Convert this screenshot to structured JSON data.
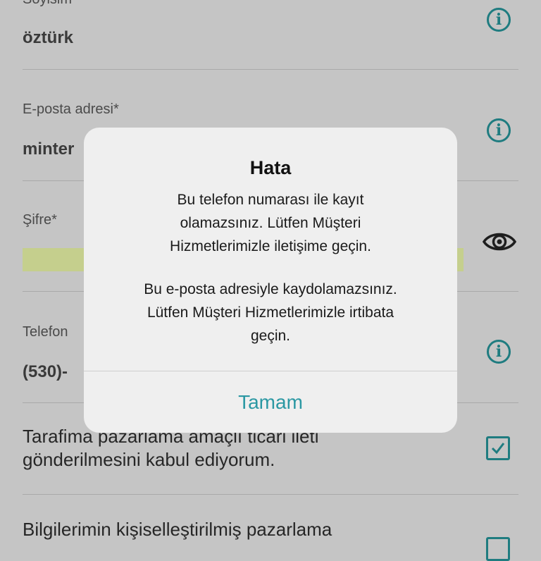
{
  "form": {
    "surname": {
      "label": "Soyisim",
      "value": "öztürk"
    },
    "email": {
      "label": "E-posta adresi*",
      "value": "minter"
    },
    "password": {
      "label": "Şifre*"
    },
    "phone": {
      "label": "Telefon",
      "value": "(530)-"
    },
    "consent_marketing": {
      "text_line1": "Tarafima pazarlama amaçlı ticari ileti",
      "text_line2": "gönderilmesini kabul ediyorum.",
      "checked": true
    },
    "consent_personalized": {
      "text_line1": "Bilgilerimin kişiselleştirilmiş pazarlama"
    }
  },
  "icons": {
    "info": "info-icon",
    "eye": "eye-icon",
    "checkbox": "checkbox-checked-icon"
  },
  "colors": {
    "accent": "#1f7c80",
    "dialog_button": "#2b98a3",
    "strength_bar": "#c5cf8d"
  },
  "alert": {
    "title": "Hata",
    "message1_line1": "Bu telefon numarası ile kayıt",
    "message1_line2": "olamazsınız. Lütfen Müşteri",
    "message1_line3": "Hizmetlerimizle iletişime geçin.",
    "message2_line1": "Bu e-posta adresiyle kaydolamazsınız.",
    "message2_line2": "Lütfen Müşteri Hizmetlerimizle irtibata",
    "message2_line3": "geçin.",
    "ok_button": "Tamam"
  }
}
